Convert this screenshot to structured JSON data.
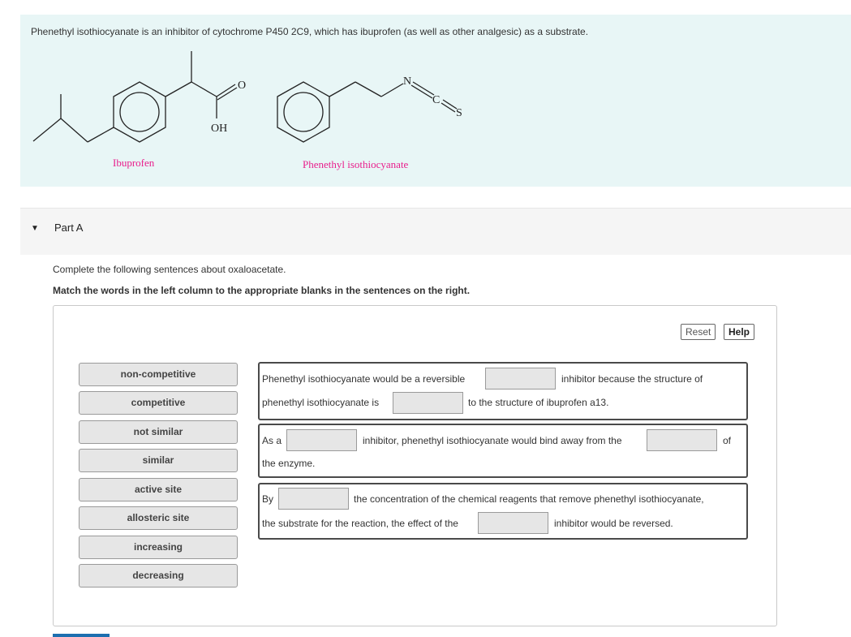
{
  "intro": {
    "text": "Phenethyl isothiocyanate is an inhibitor of cytochrome P450 2C9, which has ibuprofen (as well as other analgesic) as a substrate.",
    "molecules": [
      {
        "label": "Ibuprofen",
        "atoms": [
          "O",
          "OH"
        ]
      },
      {
        "label": "Phenethyl isothiocyanate",
        "atoms": [
          "N",
          "C",
          "S"
        ]
      }
    ]
  },
  "part": {
    "title": "Part A"
  },
  "instructions": {
    "line1": "Complete the following sentences about oxaloacetate.",
    "line2": "Match the words in the left column to the appropriate blanks in the sentences on the right."
  },
  "toolbar": {
    "reset_label": "Reset",
    "help_label": "Help"
  },
  "word_bank": [
    "non-competitive",
    "competitive",
    "not similar",
    "similar",
    "active site",
    "allosteric site",
    "increasing",
    "decreasing"
  ],
  "sentences": [
    {
      "parts": [
        "Phenethyl isothiocyanate would be a reversible",
        "inhibitor because the structure of",
        "phenethyl isothiocyanate is",
        "to the structure of ibuprofen a13."
      ]
    },
    {
      "parts": [
        "As a",
        "inhibitor, phenethyl isothiocyanate would bind away from the",
        "of",
        "the enzyme."
      ]
    },
    {
      "parts": [
        "By",
        "the concentration of the chemical reagents that remove phenethyl isothiocyanate,",
        "the substrate for the reaction, the effect of the",
        "inhibitor would be reversed."
      ]
    }
  ],
  "colors": {
    "intro_bg": "#e8f6f6",
    "molecule_label": "#e91e8c",
    "blank_bg": "#e6e6e6"
  }
}
